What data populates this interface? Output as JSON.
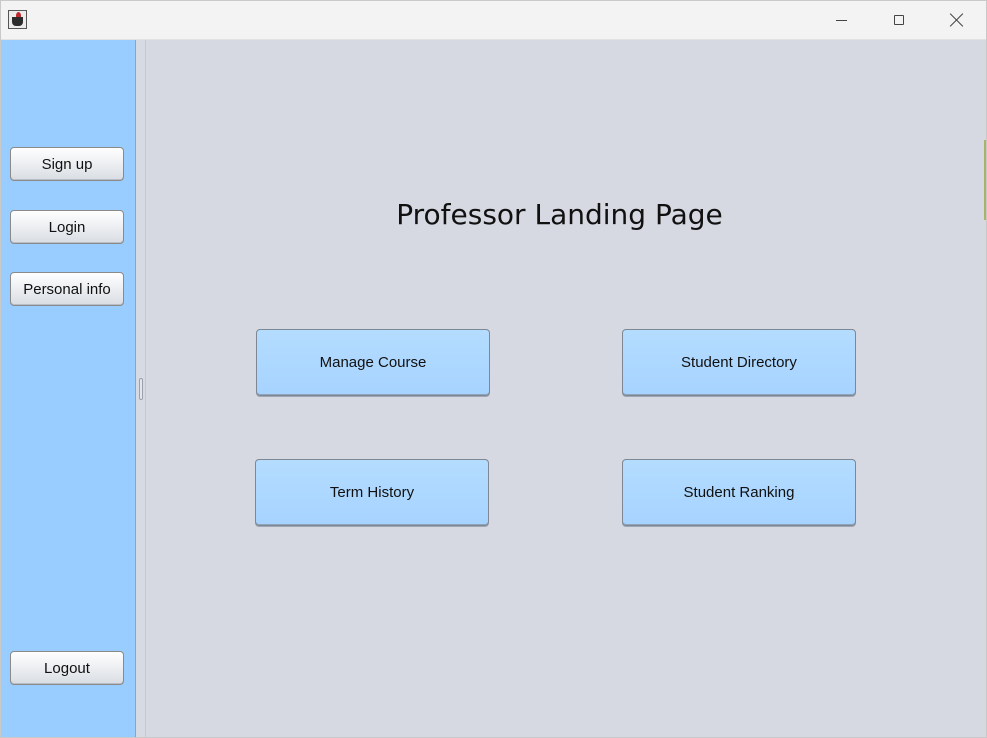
{
  "sidebar": {
    "buttons": {
      "signup": "Sign up",
      "login": "Login",
      "personal_info": "Personal info",
      "logout": "Logout"
    },
    "color": "#99ccff"
  },
  "main": {
    "title": "Professor Landing Page",
    "actions": {
      "manage_course": "Manage Course",
      "student_directory": "Student Directory",
      "term_history": "Term History",
      "student_ranking": "Student Ranking"
    },
    "background": "#d6d9e1",
    "button_color": "#a6d3ff"
  },
  "window": {
    "icon": "java-cup-icon",
    "controls": [
      "minimize-icon",
      "maximize-icon",
      "close-icon"
    ]
  }
}
